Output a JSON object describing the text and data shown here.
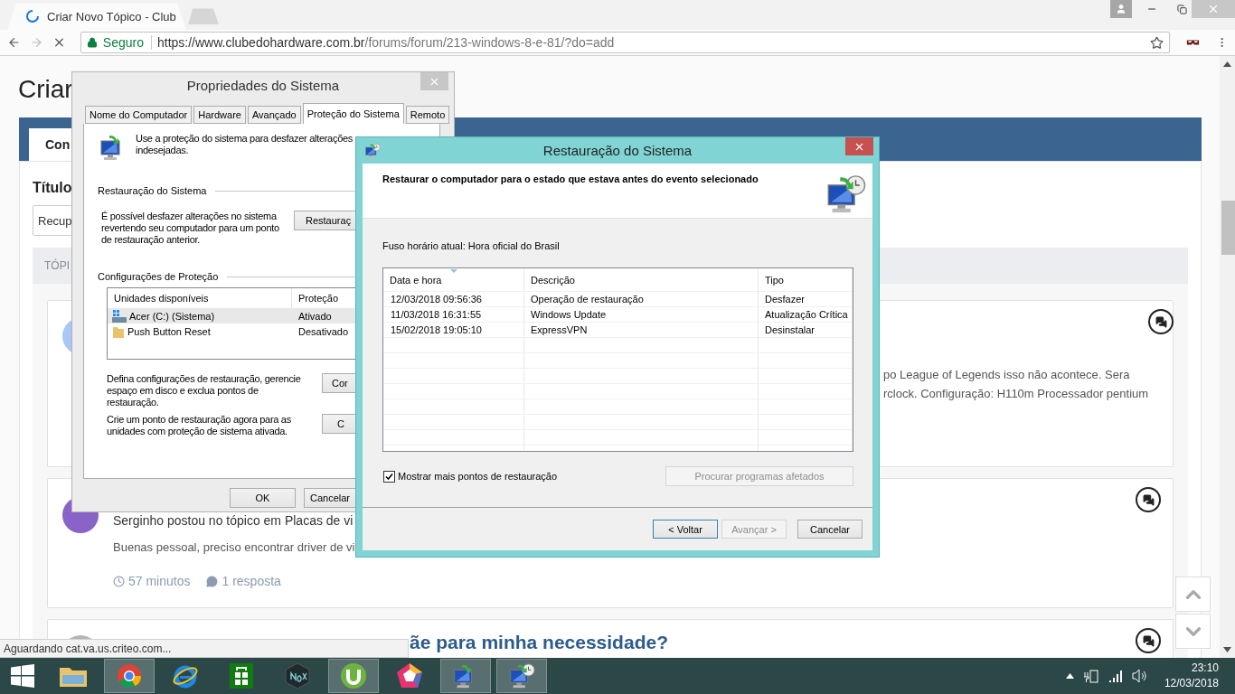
{
  "browser": {
    "tab": {
      "title": "Criar Novo Tópico - Club"
    },
    "address_bar": {
      "security": "Seguro",
      "url_host": "https://www.clubedohardware.com.br",
      "url_path": "/forums/forum/213-windows-8-e-81/?do=add"
    },
    "status_bubble": "Aguardando cat.va.us.criteo.com..."
  },
  "page": {
    "heading": "Criar",
    "tab": "Con",
    "title_label": "Título",
    "title_value": "Recup",
    "section_label": "TÓPI",
    "posts": [
      {
        "kind": "excerpt",
        "lines": [
          "po League of Legends isso não acontece. Sera",
          "rclock. Configuração: H110m Processador pentium"
        ]
      },
      {
        "kind": "activity",
        "byline": "Serginho postou no tópico em Placas de vi",
        "excerpt": "Buenas pessoal, preciso encontrar driver de vi",
        "time": "57 minutos",
        "replies": "1 resposta"
      },
      {
        "kind": "title",
        "title": "ãe para minha necessidade?"
      }
    ]
  },
  "system_properties": {
    "title": "Propriedades do Sistema",
    "tabs": [
      {
        "label": "Nome do Computador",
        "selected": false
      },
      {
        "label": "Hardware",
        "selected": false
      },
      {
        "label": "Avançado",
        "selected": false
      },
      {
        "label": "Proteção do Sistema",
        "selected": true
      },
      {
        "label": "Remoto",
        "selected": false
      }
    ],
    "intro_lines": [
      "Use a proteção do sistema para desfazer alterações",
      "indesejadas."
    ],
    "restore": {
      "group_title": "Restauração do Sistema",
      "lines": [
        "É possível desfazer alterações no sistema",
        "revertendo seu computador para um ponto",
        "de restauração anterior."
      ],
      "button": "Restauraç"
    },
    "protection": {
      "group_title": "Configurações de Proteção",
      "columns": [
        "Unidades disponíveis",
        "Proteção"
      ],
      "drives": [
        {
          "kind": "drive",
          "name": "Acer (C:) (Sistema)",
          "protection": "Ativado",
          "selected": true
        },
        {
          "kind": "folder",
          "name": "Push Button Reset",
          "protection": "Desativado",
          "selected": false
        }
      ],
      "config_lines": [
        "Defina configurações de restauração, gerencie",
        "espaço em disco e exclua pontos de",
        "restauração."
      ],
      "config_button": "Cor",
      "create_lines": [
        "Crie um ponto de restauração agora para as",
        "unidades com proteção de sistema ativada."
      ],
      "create_button": "C"
    },
    "buttons": [
      "OK",
      "Cancelar"
    ]
  },
  "system_restore": {
    "title": "Restauração do Sistema",
    "heading": "Restaurar o computador para o estado que estava antes do evento selecionado",
    "timezone": "Fuso horário atual: Hora oficial do Brasil",
    "columns": [
      "Data e hora",
      "Descrição",
      "Tipo"
    ],
    "rows": [
      {
        "date": "12/03/2018 09:56:36",
        "description": "Operação de restauração",
        "type": "Desfazer"
      },
      {
        "date": "11/03/2018 16:31:55",
        "description": "Windows Update",
        "type": "Atualização Crítica"
      },
      {
        "date": "15/02/2018 19:05:10",
        "description": "ExpressVPN",
        "type": "Desinstalar"
      }
    ],
    "show_more": {
      "label": "Mostrar mais pontos de restauração",
      "checked": true
    },
    "affected_button": {
      "label": "Procurar programas afetados",
      "disabled": true
    },
    "buttons": [
      {
        "label": "< Voltar",
        "default": true,
        "disabled": false
      },
      {
        "label": "Avançar >",
        "default": false,
        "disabled": true
      },
      {
        "label": "Cancelar",
        "default": false,
        "disabled": false
      }
    ]
  },
  "taskbar": {
    "apps": [
      {
        "kind": "folder",
        "active": false
      },
      {
        "kind": "chrome",
        "active": true
      },
      {
        "kind": "ie",
        "active": false
      },
      {
        "kind": "store",
        "active": false
      },
      {
        "kind": "nox",
        "active": false
      },
      {
        "kind": "torrent",
        "active": true
      },
      {
        "kind": "pentagon",
        "active": false
      },
      {
        "kind": "sysprops",
        "active": true
      },
      {
        "kind": "restore",
        "active": true
      }
    ],
    "time": "23:10",
    "date": "12/03/2018"
  }
}
